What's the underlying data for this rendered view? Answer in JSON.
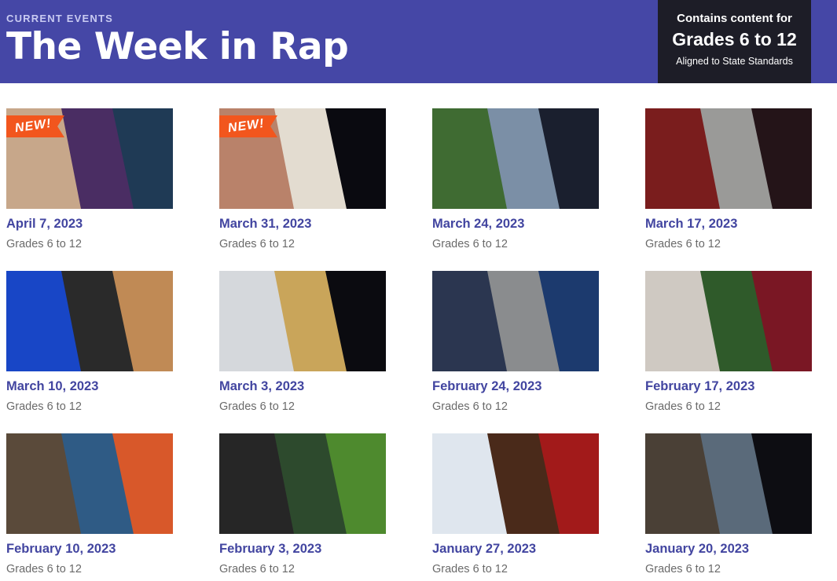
{
  "header": {
    "eyebrow": "CURRENT EVENTS",
    "title": "The Week in Rap",
    "grade_box": {
      "line1": "Contains content for",
      "line2": "Grades 6 to 12",
      "line3": "Aligned to State Standards"
    }
  },
  "colors": {
    "header_bg": "#4547a6",
    "grade_box_bg": "#1d1d27",
    "date_link": "#4245a0",
    "new_badge": "#f2561d"
  },
  "episodes": [
    {
      "date": "April 7, 2023",
      "grades": "Grades 6 to 12",
      "badge": "NEW!",
      "thumb": [
        "#c7a78a",
        "#4a2d63",
        "#1f3a55"
      ]
    },
    {
      "date": "March 31, 2023",
      "grades": "Grades 6 to 12",
      "badge": "NEW!",
      "thumb": [
        "#b9826a",
        "#e3dcd0",
        "#0a0a10"
      ]
    },
    {
      "date": "March 24, 2023",
      "grades": "Grades 6 to 12",
      "badge": "",
      "thumb": [
        "#3f6b32",
        "#7b8fa6",
        "#1a1f2e"
      ]
    },
    {
      "date": "March 17, 2023",
      "grades": "Grades 6 to 12",
      "badge": "",
      "thumb": [
        "#7a1d1d",
        "#9a9a98",
        "#241418"
      ]
    },
    {
      "date": "March 10, 2023",
      "grades": "Grades 6 to 12",
      "badge": "",
      "thumb": [
        "#1846c6",
        "#2a2a2a",
        "#c08a55"
      ]
    },
    {
      "date": "March 3, 2023",
      "grades": "Grades 6 to 12",
      "badge": "",
      "thumb": [
        "#d5d8dc",
        "#c9a55a",
        "#0b0b10"
      ]
    },
    {
      "date": "February 24, 2023",
      "grades": "Grades 6 to 12",
      "badge": "",
      "thumb": [
        "#2b3650",
        "#8a8c8e",
        "#1c3a6e"
      ]
    },
    {
      "date": "February 17, 2023",
      "grades": "Grades 6 to 12",
      "badge": "",
      "thumb": [
        "#cfc9c2",
        "#2f5a2a",
        "#7a1724"
      ]
    },
    {
      "date": "February 10, 2023",
      "grades": "Grades 6 to 12",
      "badge": "",
      "thumb": [
        "#5a4a3a",
        "#2f5b85",
        "#d8582a"
      ]
    },
    {
      "date": "February 3, 2023",
      "grades": "Grades 6 to 12",
      "badge": "",
      "thumb": [
        "#262626",
        "#2d4a2d",
        "#4e8a2e"
      ]
    },
    {
      "date": "January 27, 2023",
      "grades": "Grades 6 to 12",
      "badge": "",
      "thumb": [
        "#dfe6ee",
        "#4a2a1a",
        "#a21a1a"
      ]
    },
    {
      "date": "January 20, 2023",
      "grades": "Grades 6 to 12",
      "badge": "",
      "thumb": [
        "#4a4036",
        "#5a6a7a",
        "#0d0d12"
      ]
    }
  ]
}
